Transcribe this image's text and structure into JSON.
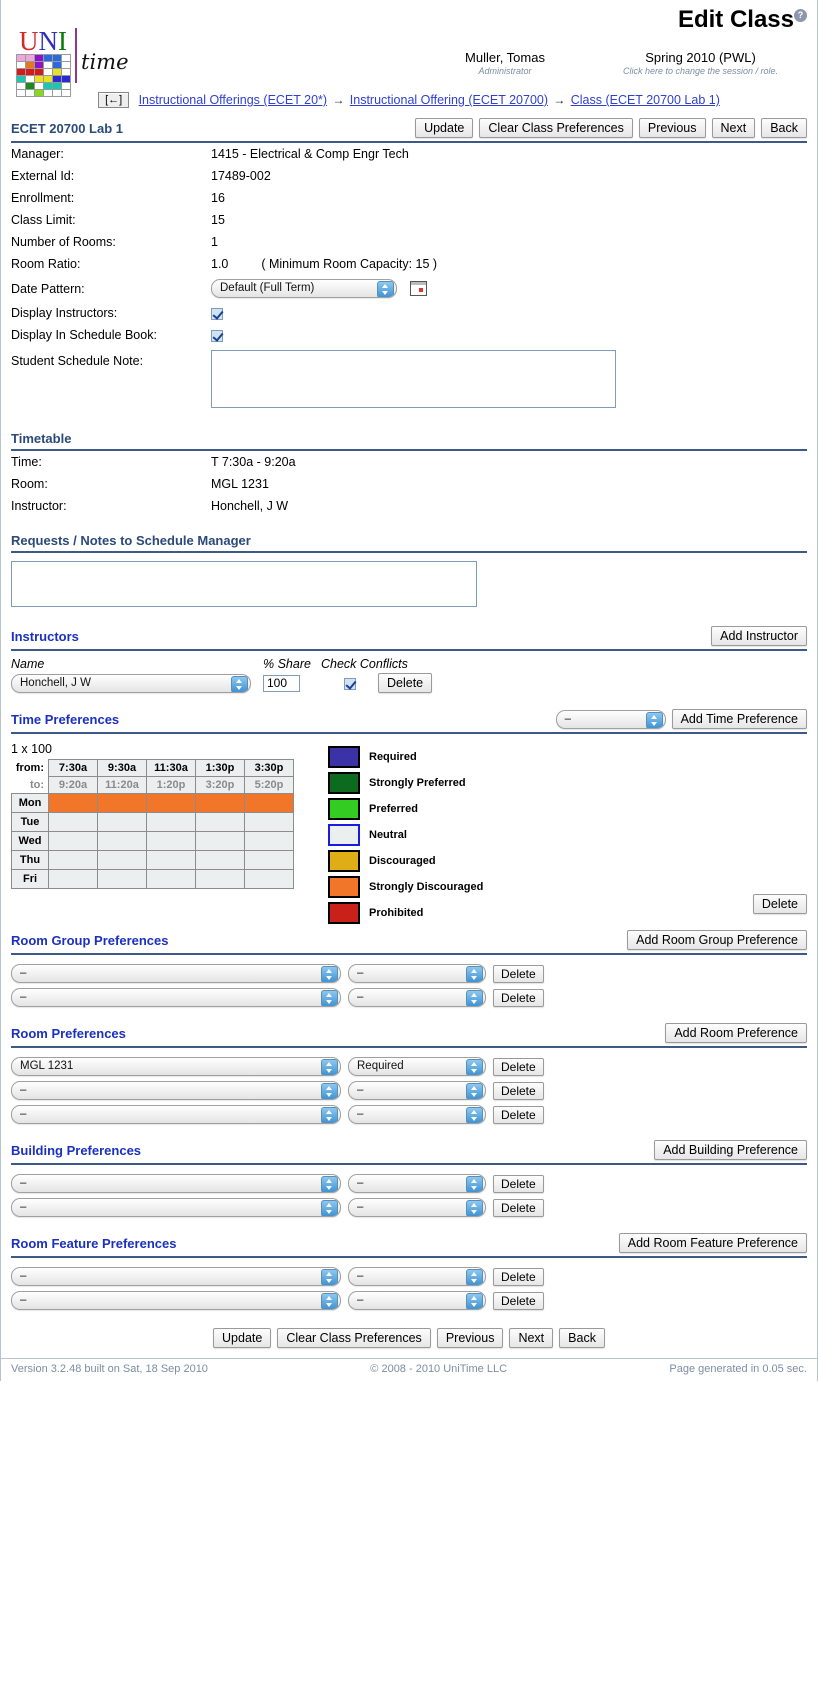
{
  "header": {
    "title": "Edit Class",
    "help_icon": "help-question-icon",
    "user_name": "Muller, Tomas",
    "user_role": "Administrator",
    "session": "Spring 2010 (PWL)",
    "session_hint": "Click here to change the session / role.",
    "back_arrow": "[←]",
    "breadcrumb": [
      "Instructional Offerings (ECET 20*)",
      "Instructional Offering (ECET 20700)",
      "Class (ECET 20700 Lab 1)"
    ],
    "breadcrumb_sep": "→"
  },
  "toolbar": {
    "update": "Update",
    "clear": "Clear Class Preferences",
    "previous": "Previous",
    "next": "Next",
    "back": "Back"
  },
  "class": {
    "name": "ECET 20700 Lab 1",
    "fields": [
      {
        "label": "Manager:",
        "value": "1415 - Electrical & Comp Engr Tech"
      },
      {
        "label": "External Id:",
        "value": "17489-002"
      },
      {
        "label": "Enrollment:",
        "value": "16"
      },
      {
        "label": "Class Limit:",
        "value": "15"
      },
      {
        "label": "Number of Rooms:",
        "value": "1"
      },
      {
        "label": "Room Ratio:",
        "value": "1.0",
        "extra": "( Minimum Room Capacity: 15 )"
      }
    ],
    "date_pattern_label": "Date Pattern:",
    "date_pattern_value": "Default (Full Term)",
    "display_instructors_label": "Display Instructors:",
    "display_instructors_checked": true,
    "display_schedule_book_label": "Display In Schedule Book:",
    "display_schedule_book_checked": true,
    "student_note_label": "Student Schedule Note:",
    "student_note_value": ""
  },
  "timetable": {
    "title": "Timetable",
    "rows": [
      {
        "label": "Time:",
        "value": "T 7:30a - 9:20a"
      },
      {
        "label": "Room:",
        "value": "MGL 1231"
      },
      {
        "label": "Instructor:",
        "value": "Honchell, J W"
      }
    ]
  },
  "requests": {
    "title": "Requests / Notes to Schedule Manager",
    "value": ""
  },
  "instructors": {
    "title": "Instructors",
    "add_label": "Add Instructor",
    "columns": [
      "Name",
      "% Share",
      "Check Conflicts"
    ],
    "rows": [
      {
        "name": "Honchell, J W",
        "share": "100",
        "conflicts": true,
        "delete": "Delete"
      }
    ]
  },
  "time_preferences": {
    "title": "Time Preferences",
    "selector_value": "–",
    "add_label": "Add Time Preference",
    "pattern_name": "1 x 100",
    "from_label": "from:",
    "to_label": "to:",
    "from_times": [
      "7:30a",
      "9:30a",
      "11:30a",
      "1:30p",
      "3:30p"
    ],
    "to_times": [
      "9:20a",
      "11:20a",
      "1:20p",
      "3:20p",
      "5:20p"
    ],
    "days": [
      "Mon",
      "Tue",
      "Wed",
      "Thu",
      "Fri"
    ],
    "cells": [
      [
        1,
        1,
        1,
        1,
        1
      ],
      [
        0,
        0,
        0,
        0,
        0
      ],
      [
        0,
        0,
        0,
        0,
        0
      ],
      [
        0,
        0,
        0,
        0,
        0
      ],
      [
        0,
        0,
        0,
        0,
        0
      ]
    ],
    "delete_label": "Delete",
    "legend": [
      {
        "label": "Required",
        "color": "#3b32a8"
      },
      {
        "label": "Strongly Preferred",
        "color": "#0c6b1e"
      },
      {
        "label": "Preferred",
        "color": "#33cc22"
      },
      {
        "label": "Neutral",
        "color": "#eceff0",
        "border": "#1a1ae0"
      },
      {
        "label": "Discouraged",
        "color": "#dfae16"
      },
      {
        "label": "Strongly Discouraged",
        "color": "#f2762a"
      },
      {
        "label": "Prohibited",
        "color": "#c9201a"
      }
    ],
    "on_color": "#f2762a",
    "off_color": "#eceff0"
  },
  "room_group_preferences": {
    "title": "Room Group Preferences",
    "add_label": "Add Room Group Preference",
    "rows": [
      {
        "item": "–",
        "level": "–",
        "delete": "Delete"
      },
      {
        "item": "–",
        "level": "–",
        "delete": "Delete"
      }
    ]
  },
  "room_preferences": {
    "title": "Room Preferences",
    "add_label": "Add Room Preference",
    "rows": [
      {
        "item": "MGL 1231",
        "level": "Required",
        "delete": "Delete"
      },
      {
        "item": "–",
        "level": "–",
        "delete": "Delete"
      },
      {
        "item": "–",
        "level": "–",
        "delete": "Delete"
      }
    ]
  },
  "building_preferences": {
    "title": "Building Preferences",
    "add_label": "Add Building Preference",
    "rows": [
      {
        "item": "–",
        "level": "–",
        "delete": "Delete"
      },
      {
        "item": "–",
        "level": "–",
        "delete": "Delete"
      }
    ]
  },
  "room_feature_preferences": {
    "title": "Room Feature Preferences",
    "add_label": "Add Room Feature Preference",
    "rows": [
      {
        "item": "–",
        "level": "–",
        "delete": "Delete"
      },
      {
        "item": "–",
        "level": "–",
        "delete": "Delete"
      }
    ]
  },
  "footer": {
    "version": "Version 3.2.48 built on Sat, 18 Sep 2010",
    "copyright": "© 2008 - 2010 UniTime LLC",
    "generated": "Page generated in 0.05 sec."
  }
}
